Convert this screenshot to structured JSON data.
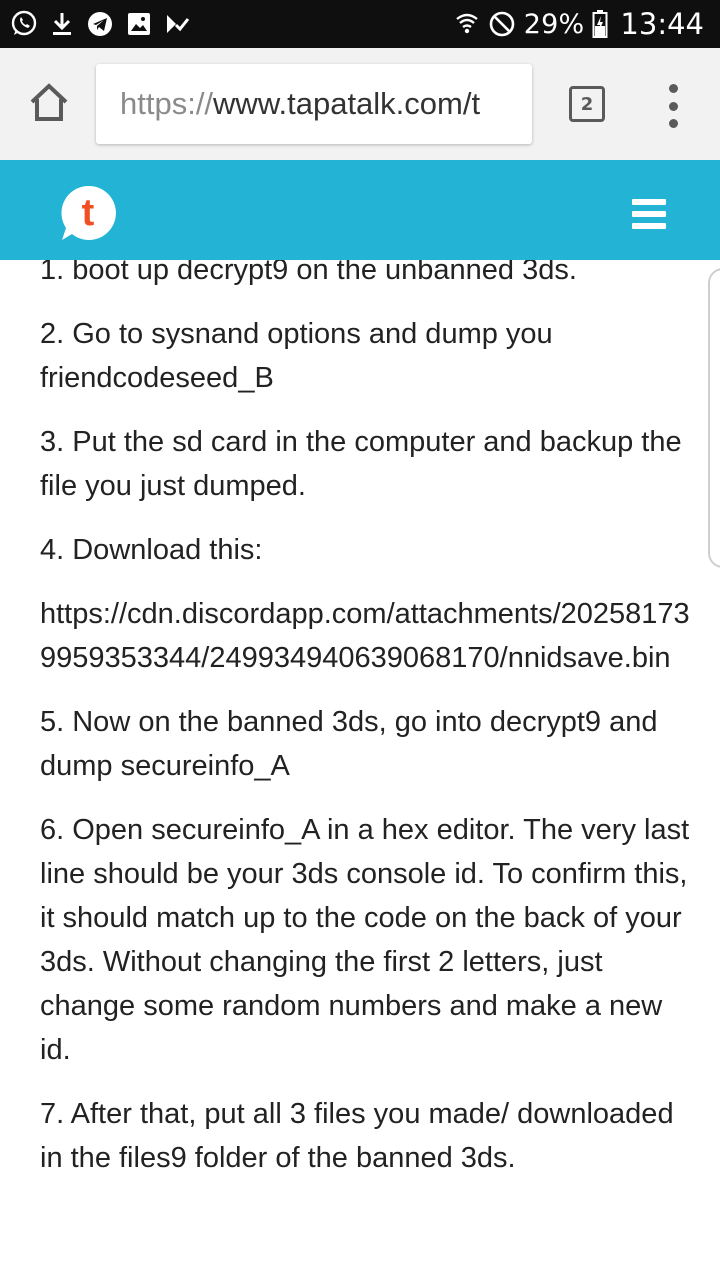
{
  "status_bar": {
    "icons_left": [
      "whatsapp-icon",
      "download-icon",
      "telegram-icon",
      "gallery-icon",
      "tasks-icon"
    ],
    "icons_right": [
      "wifi-icon",
      "do-not-disturb-icon",
      "battery-charging-icon"
    ],
    "battery": "29%",
    "time": "13:44"
  },
  "browser": {
    "url_scheme": "https://",
    "url_rest": "www.tapatalk.com/t",
    "tab_count": "2",
    "icons": [
      "home-icon",
      "tabs-icon",
      "more-vert-icon"
    ]
  },
  "site": {
    "brand_letter": "t",
    "colors": {
      "header": "#23b3d4",
      "logo_letter": "#f04e23",
      "link": "#1a8ec6"
    }
  },
  "post": {
    "step1": "1. boot up decrypt9 on the unbanned 3ds.",
    "step2": "2. Go to sysnand options and dump you friendcodeseed_B",
    "step3": "3. Put the sd card in the computer and backup the file you just dumped.",
    "step4": "4. Download this:",
    "link": "https://cdn.discordapp.com/attachments/202581739959353344/249934940639068170/nnidsave.bin",
    "step5": "5. Now on the banned 3ds, go into decrypt9 and dump secureinfo_A",
    "step6": "6. Open secureinfo_A in a hex editor. The very last line should be your 3ds console id. To confirm this, it should match up to the code on the back of your 3ds. Without changing the first 2 letters, just change some random numbers and make a new id.",
    "step7": "7. After that, put all 3 files you made/ downloaded in the files9 folder of the banned 3ds."
  }
}
